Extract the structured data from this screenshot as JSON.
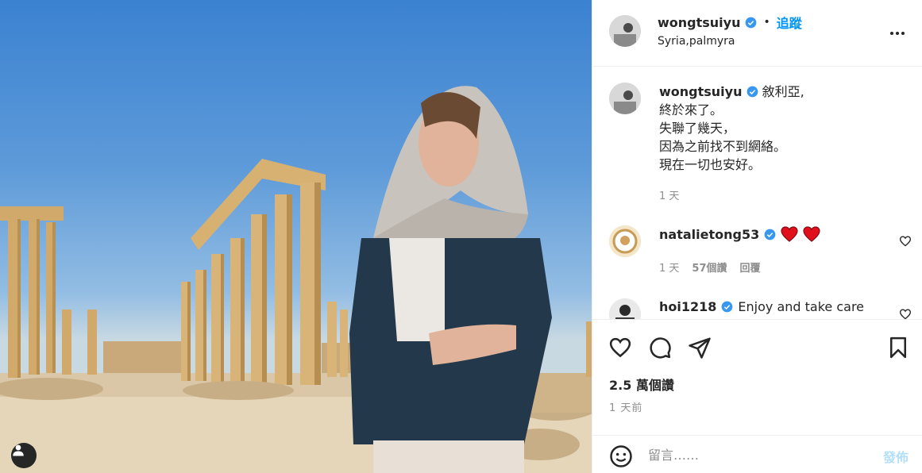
{
  "post": {
    "username": "wongtsuiyu",
    "follow_label": "追蹤",
    "dot": "•",
    "location": "Syria,palmyra",
    "caption_lines": [
      "敘利亞,",
      "終於來了。",
      "失聯了幾天，",
      "因為之前找不到網絡。",
      "現在一切也安好。"
    ],
    "caption_time": "1 天",
    "likes": "2.5 萬個讚",
    "posted": "1 天前"
  },
  "comments": [
    {
      "username": "natalietong53",
      "text": "",
      "time": "1 天",
      "likes": "57個讚",
      "reply": "回覆"
    },
    {
      "username": "hoi1218",
      "text": "Enjoy and take care"
    }
  ],
  "add_comment": {
    "placeholder": "留言……",
    "post_label": "發佈"
  },
  "colors": {
    "accent": "#0095f6",
    "verified": "#3897f0",
    "muted": "#8e8e8e",
    "heart_red": "#e0101d",
    "post_disabled": "#b2dffc"
  },
  "icons": [
    "user-tag-icon",
    "verified-icon",
    "more-icon",
    "heart-icon",
    "comment-icon",
    "share-icon",
    "bookmark-icon",
    "emoji-icon"
  ]
}
